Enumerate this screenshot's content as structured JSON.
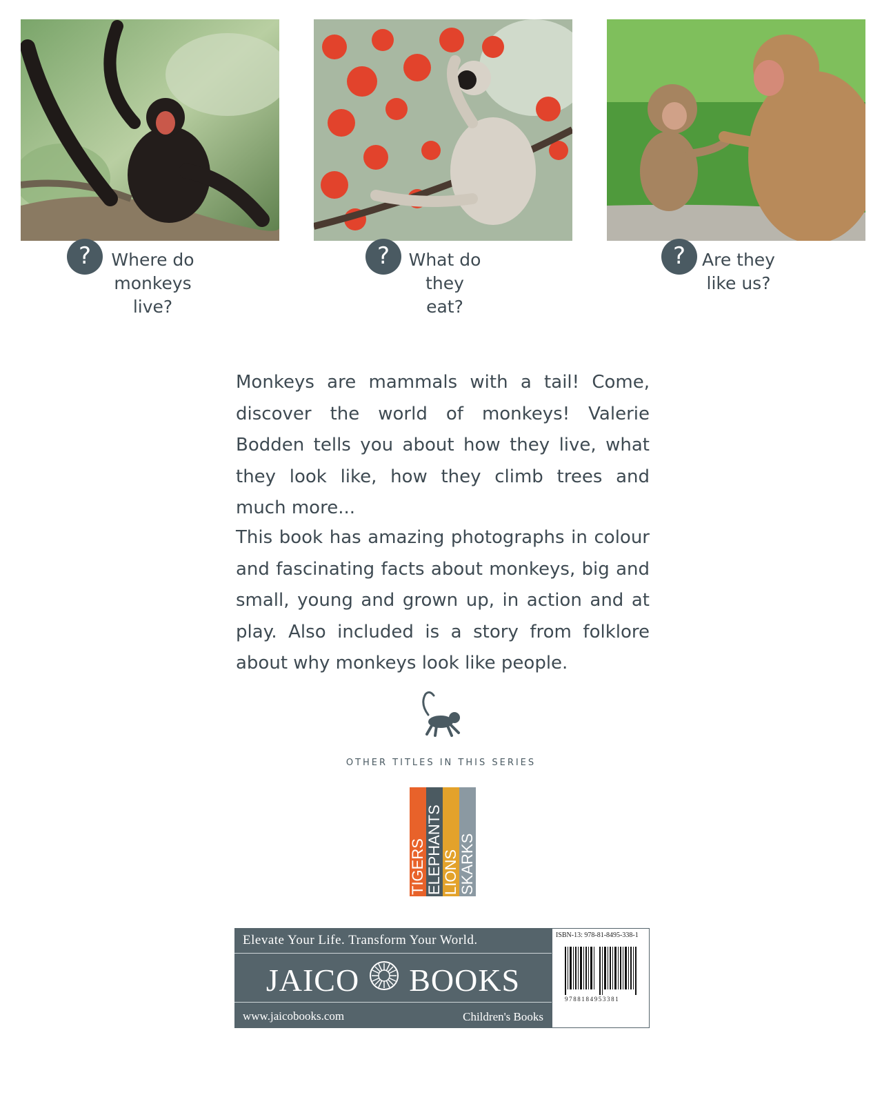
{
  "questions": [
    {
      "line1": "Where do",
      "line2": "monkeys live?",
      "badge": "?"
    },
    {
      "line1": "What do",
      "line2": "they eat?",
      "badge": "?"
    },
    {
      "line1": "Are they",
      "line2": "like us?",
      "badge": "?"
    }
  ],
  "blurb": {
    "paragraph1": "Monkeys are mammals with a tail! Come, discover the world of monkeys! Valerie Bodden tells you about how they live, what they look like, how they climb trees and much more...",
    "paragraph2": "This book has amazing photographs in colour and fascinating facts about monkeys, big and small, young and grown up, in action and at play. Also included is a story from folklore about why monkeys look like people."
  },
  "series": {
    "heading": "OTHER TITLES IN THIS SERIES",
    "titles": [
      {
        "label": "TIGERS",
        "color": "#e8622a"
      },
      {
        "label": "ELEPHANTS",
        "color": "#4b5a61"
      },
      {
        "label": "LIONS",
        "color": "#e3a22b"
      },
      {
        "label": "SKARKS",
        "color": "#8b99a2"
      }
    ]
  },
  "publisher": {
    "tagline": "Elevate Your Life. Transform Your World.",
    "name_left": "JAICO",
    "name_right": "BOOKS",
    "website": "www.jaicobooks.com",
    "category": "Children's Books"
  },
  "barcode": {
    "isbn": "ISBN-13: 978-81-8495-338-1",
    "digits": "9788184953381"
  },
  "colors": {
    "text": "#3e4a52",
    "badge": "#4a5a62",
    "publisher_bg": "#55646b"
  }
}
